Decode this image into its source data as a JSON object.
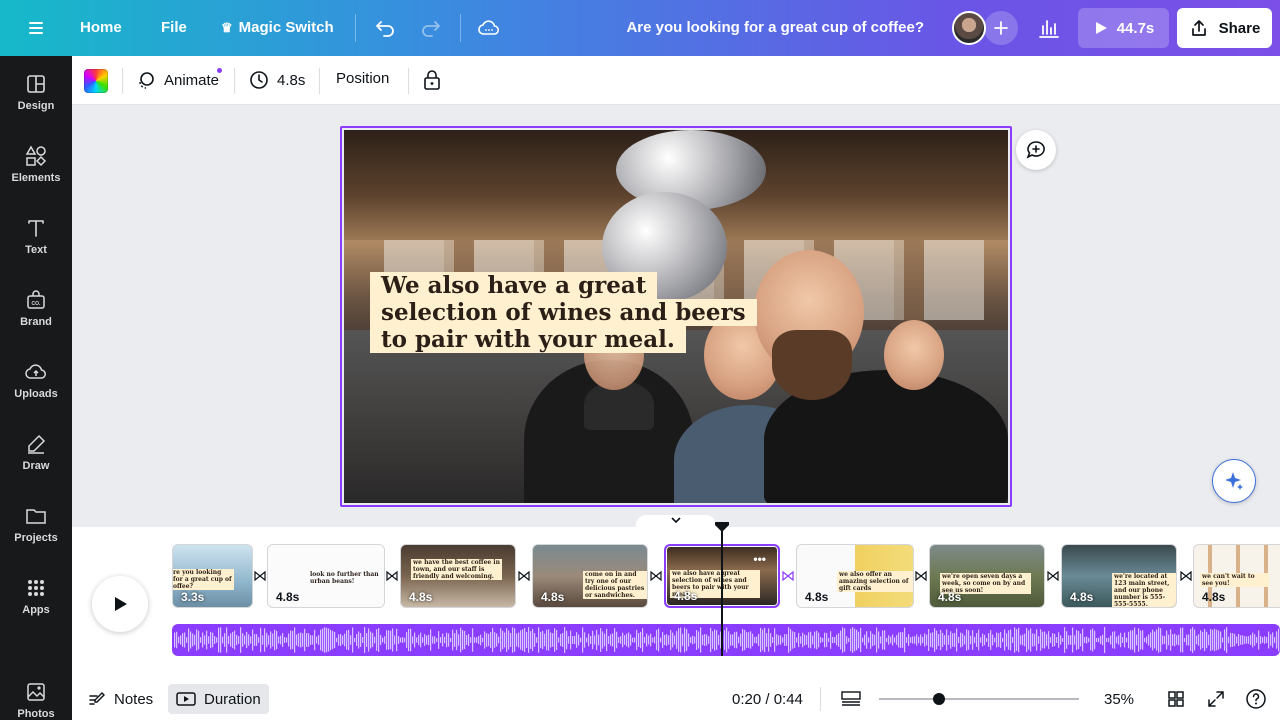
{
  "topbar": {
    "home_label": "Home",
    "file_label": "File",
    "magic_switch_label": "Magic Switch",
    "doc_title": "Are you looking for a great cup of coffee?",
    "play_duration": "44.7s",
    "share_label": "Share",
    "brand_gradient": [
      "#16b9c9",
      "#6a55e6",
      "#7b4fe8"
    ]
  },
  "sidebar": {
    "items": [
      {
        "label": "Design",
        "icon": "design-icon"
      },
      {
        "label": "Elements",
        "icon": "elements-icon"
      },
      {
        "label": "Text",
        "icon": "text-icon"
      },
      {
        "label": "Brand",
        "icon": "brand-icon"
      },
      {
        "label": "Uploads",
        "icon": "uploads-icon"
      },
      {
        "label": "Draw",
        "icon": "draw-icon"
      },
      {
        "label": "Projects",
        "icon": "projects-icon"
      },
      {
        "label": "Apps",
        "icon": "apps-icon"
      },
      {
        "label": "Photos",
        "icon": "photos-icon"
      }
    ]
  },
  "context_toolbar": {
    "animate_label": "Animate",
    "duration_label": "4.8s",
    "position_label": "Position"
  },
  "canvas": {
    "caption_lines": [
      "We also have a great",
      "selection of wines and beers",
      "to pair with your meal."
    ],
    "accent_color": "#8b3dff",
    "caption_bg": "#fff1cf"
  },
  "timeline": {
    "clips": [
      {
        "duration": "3.3s",
        "caption": "re you looking for a great cup of offee?"
      },
      {
        "duration": "4.8s",
        "caption": "look no further than urban beans!"
      },
      {
        "duration": "4.8s",
        "caption": "we have the best coffee in town, and our staff is friendly and welcoming."
      },
      {
        "duration": "4.8s",
        "caption": "come on in and try one of our delicious pastries or sandwiches."
      },
      {
        "duration": "4.8s",
        "caption": "we also have a great selection of wines and beers to pair with your meal."
      },
      {
        "duration": "4.8s",
        "caption": "we also offer an amazing selection of gift cards"
      },
      {
        "duration": "4.8s",
        "caption": "we're open seven days a week, so come on by and see us soon!"
      },
      {
        "duration": "4.8s",
        "caption": "we're located at 123 main street, and our phone number is 555-555-5555."
      },
      {
        "duration": "4.8s",
        "caption": "we can't wait to see you!"
      }
    ],
    "active_clip_index": 4
  },
  "footer": {
    "notes_label": "Notes",
    "duration_label": "Duration",
    "time_readout": "0:20 / 0:44",
    "zoom_percent": "35%",
    "zoom_level_fraction": 0.3
  }
}
